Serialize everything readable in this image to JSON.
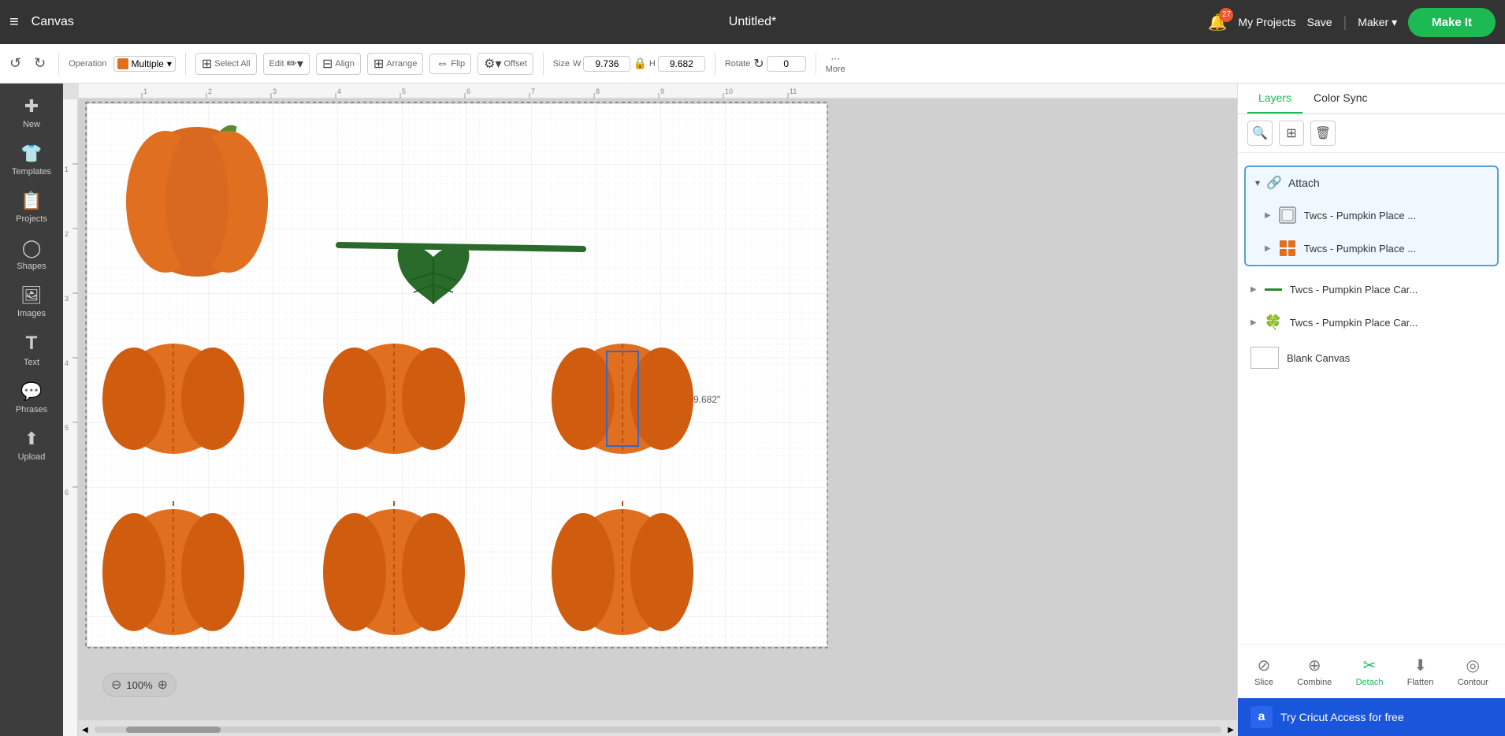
{
  "topbar": {
    "menu_label": "≡",
    "canvas_label": "Canvas",
    "title": "Untitled*",
    "bell_count": "27",
    "my_projects": "My Projects",
    "save": "Save",
    "divider": "|",
    "maker": "Maker",
    "make_it": "Make It"
  },
  "toolbar": {
    "operation_label": "Operation",
    "select_all": "Select All",
    "edit": "Edit",
    "align": "Align",
    "arrange": "Arrange",
    "flip": "Flip",
    "offset": "Offset",
    "size": "Size",
    "rotate": "Rotate",
    "more": "More",
    "op_value": "Multiple",
    "width": "9.736",
    "height": "9.682",
    "rotate_val": "0"
  },
  "sidebar": {
    "items": [
      {
        "icon": "✚",
        "label": "New"
      },
      {
        "icon": "👕",
        "label": "Templates"
      },
      {
        "icon": "📋",
        "label": "Projects"
      },
      {
        "icon": "◯",
        "label": "Shapes"
      },
      {
        "icon": "🖼",
        "label": "Images"
      },
      {
        "icon": "T",
        "label": "Text"
      },
      {
        "icon": "💬",
        "label": "Phrases"
      },
      {
        "icon": "⬆",
        "label": "Upload"
      }
    ]
  },
  "layers_panel": {
    "tab1": "Layers",
    "tab2": "Color Sync",
    "attach_label": "Attach",
    "layer1_name": "Twcs - Pumpkin Place ...",
    "layer2_name": "Twcs - Pumpkin Place ...",
    "layer3_name": "Twcs - Pumpkin Place Car...",
    "layer4_name": "Twcs - Pumpkin Place Car...",
    "blank_canvas": "Blank Canvas"
  },
  "actions": {
    "slice": "Slice",
    "combine": "Combine",
    "detach": "Detach",
    "flatten": "Flatten",
    "contour": "Contour"
  },
  "banner": {
    "icon": "a",
    "text": "Try Cricut Access for free"
  },
  "zoom": {
    "level": "100%"
  },
  "size_indicator": "9.682\""
}
